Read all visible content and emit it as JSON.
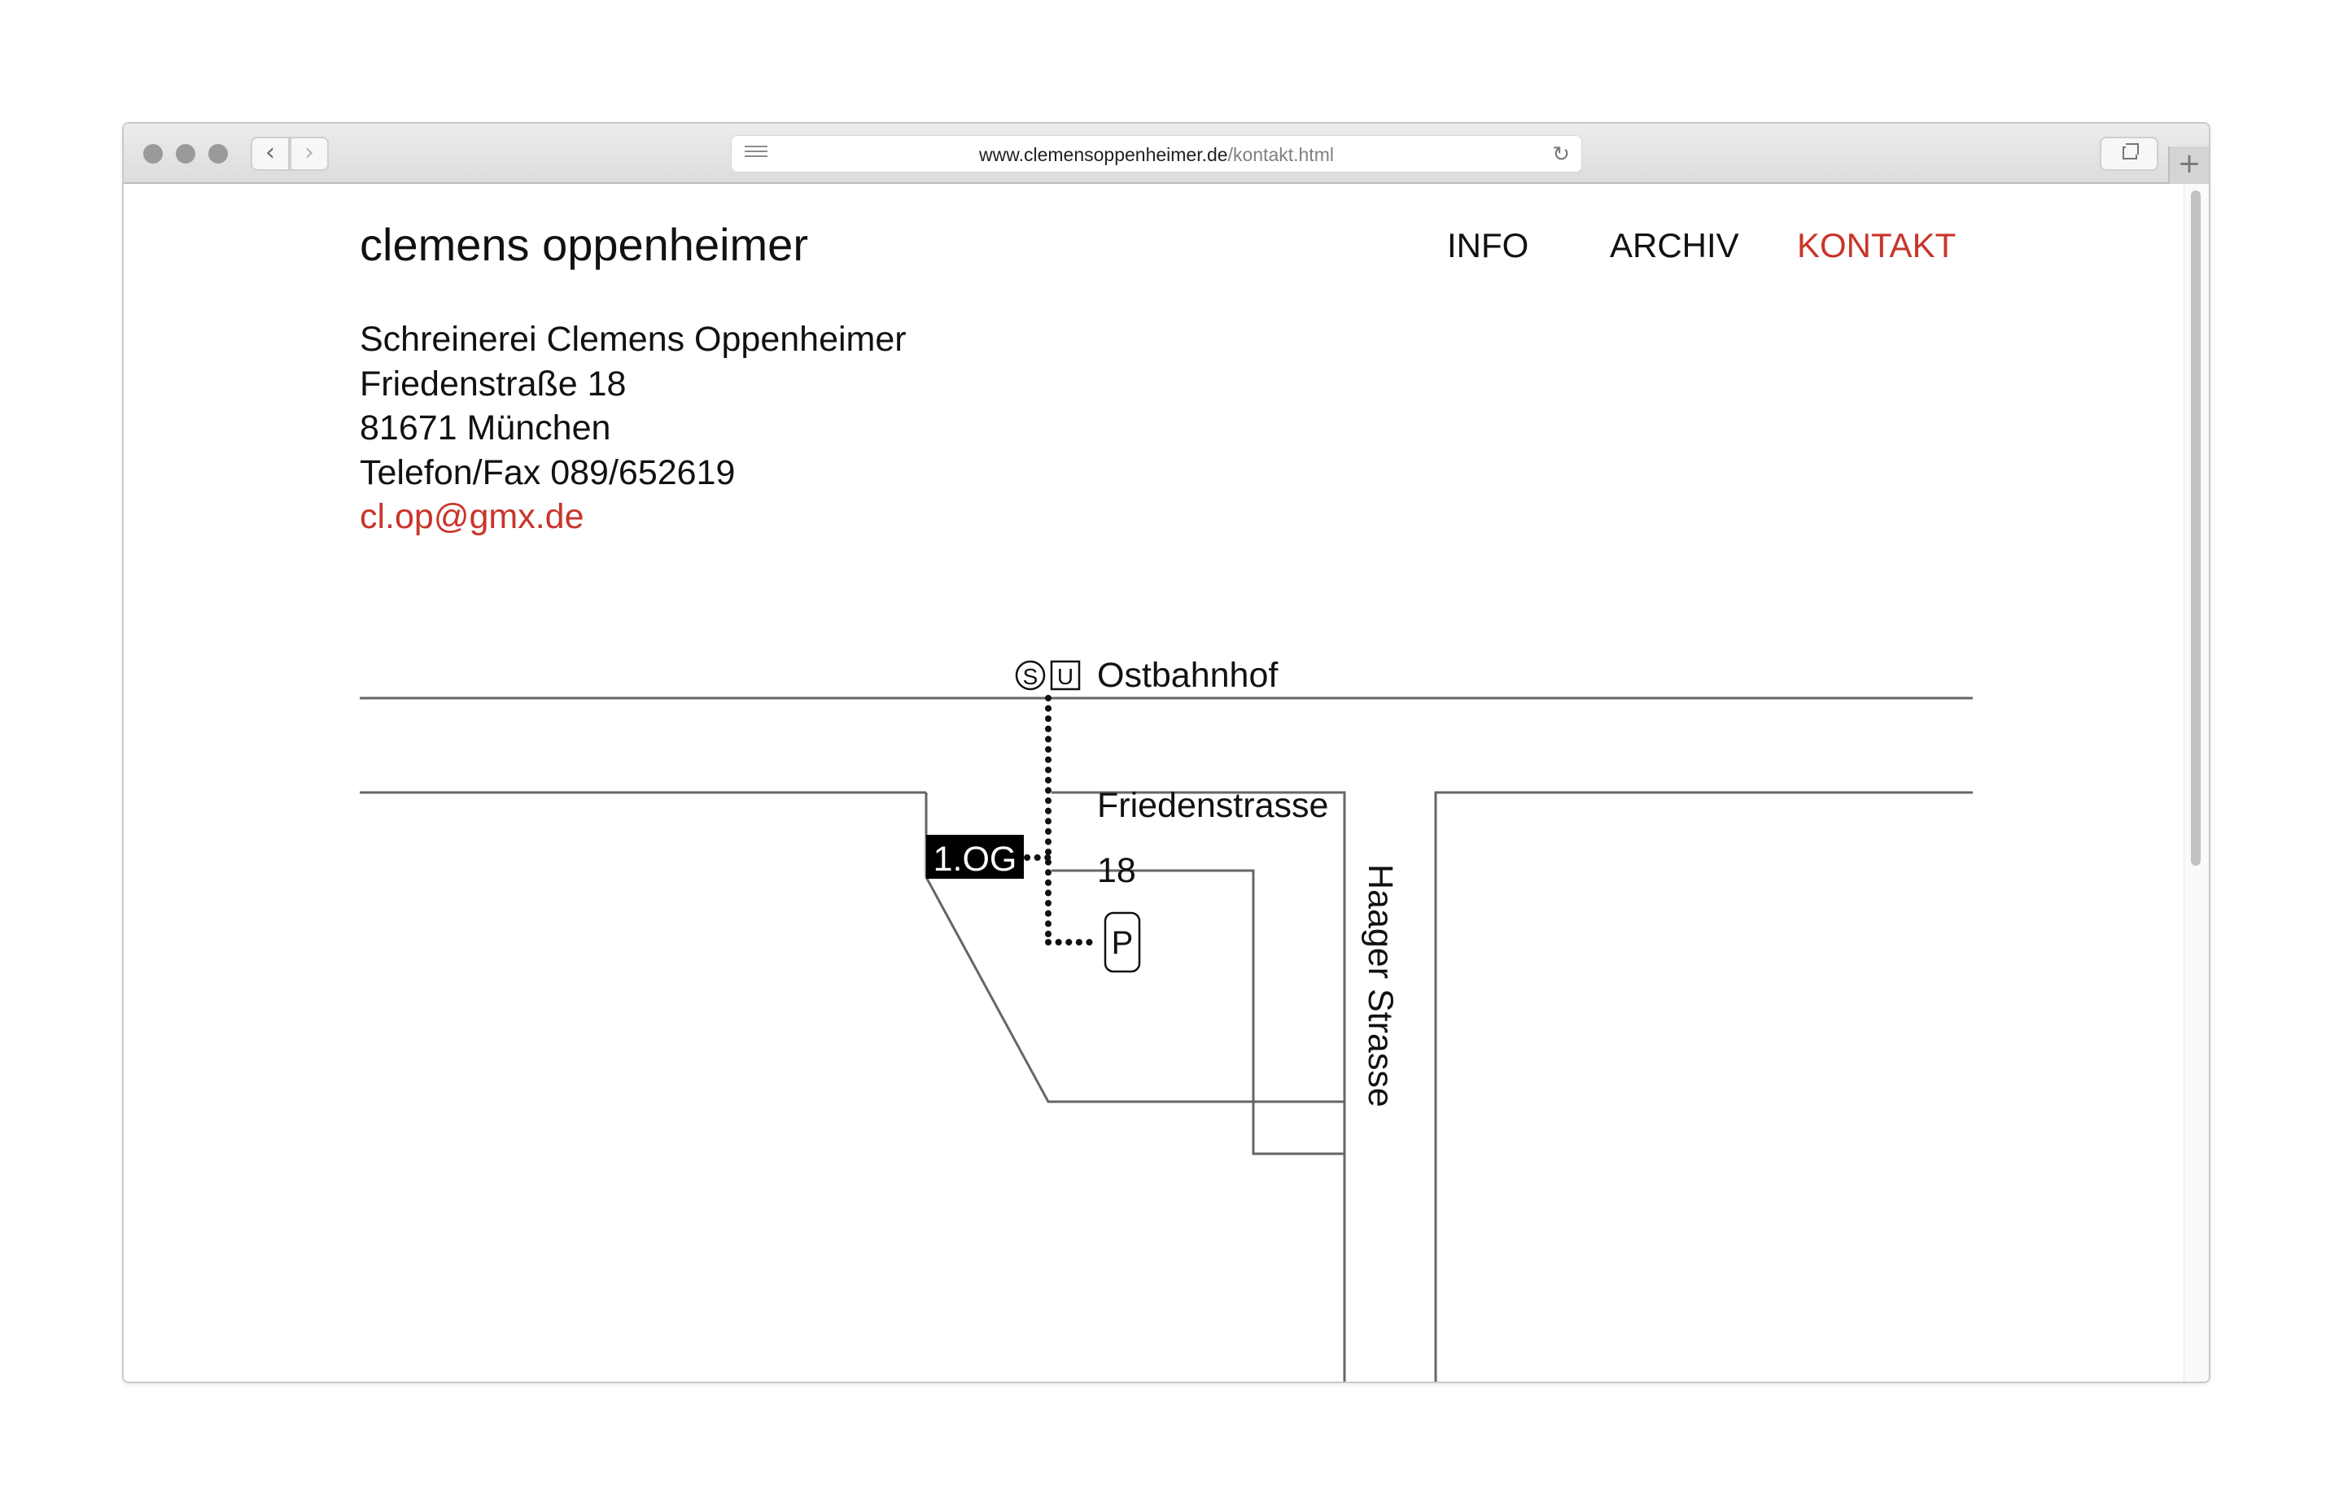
{
  "browser": {
    "url_domain": "www.clemensoppenheimer.de",
    "url_path": "/kontakt.html",
    "back_glyph": "‹",
    "forward_glyph": "›",
    "reload_glyph": "↻",
    "newtab_glyph": "+"
  },
  "site": {
    "title": "clemens oppenheimer",
    "nav": {
      "info": "INFO",
      "archiv": "ARCHIV",
      "kontakt": "KONTAKT"
    },
    "accent_color": "#c9352b"
  },
  "contact": {
    "company": "Schreinerei Clemens Oppenheimer",
    "street": "Friedenstraße 18",
    "city": "81671 München",
    "phone": "Telefon/Fax 089/652619",
    "email": "cl.op@gmx.de"
  },
  "map": {
    "s_badge": "S",
    "u_badge": "U",
    "station": "Ostbahnhof",
    "street_main": "Friedenstrasse",
    "house_number": "18",
    "floor": "1.OG",
    "parking": "P",
    "street_side": "Haager Strasse"
  }
}
